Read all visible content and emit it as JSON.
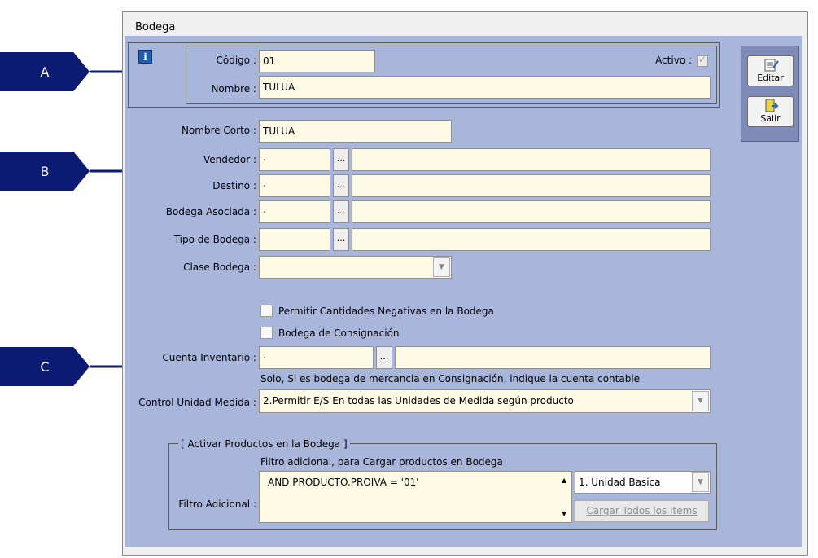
{
  "window": {
    "title": "Bodega"
  },
  "header": {
    "codigo_label": "Código :",
    "codigo_value": "01",
    "activo_label": "Activo :",
    "nombre_label": "Nombre :",
    "nombre_value": "TULUA"
  },
  "toolbar": {
    "editar_label": "Editar",
    "salir_label": "Salir"
  },
  "details": {
    "nombre_corto_label": "Nombre Corto :",
    "nombre_corto_value": "TULUA",
    "vendedor_label": "Vendedor :",
    "vendedor_code": ".",
    "destino_label": "Destino :",
    "destino_code": ".",
    "bodega_asociada_label": "Bodega Asociada :",
    "bodega_asociada_code": ".",
    "tipo_bodega_label": "Tipo de Bodega :",
    "clase_bodega_label": "Clase Bodega :",
    "ellipsis": "..."
  },
  "options": {
    "permitir_negativas_label": "Permitir Cantidades Negativas en la Bodega",
    "consignacion_label": "Bodega de Consignación",
    "cuenta_inventario_label": "Cuenta Inventario :",
    "cuenta_inventario_code": ".",
    "consignacion_hint": "Solo, Si es bodega de mercancia en Consignación, indique la cuenta contable",
    "control_unidad_label": "Control Unidad Medida :",
    "control_unidad_value": "2.Permitir E/S En todas las Unidades de Medida según producto"
  },
  "productos": {
    "group_title": "[ Activar Productos en la  Bodega ]",
    "filtro_hint": "Filtro adicional, para Cargar  productos en Bodega",
    "filtro_label": "Filtro Adicional :",
    "filtro_value": "AND PRODUCTO.PROIVA = '01'",
    "unidad_value": "1. Unidad Basica",
    "cargar_label": "Cargar Todos los Items"
  },
  "annotations": {
    "a": "A",
    "b": "B",
    "c": "C"
  },
  "colors": {
    "panel": "#a9b6dc",
    "field": "#fdfbe6",
    "marker": "#0b1a73"
  }
}
